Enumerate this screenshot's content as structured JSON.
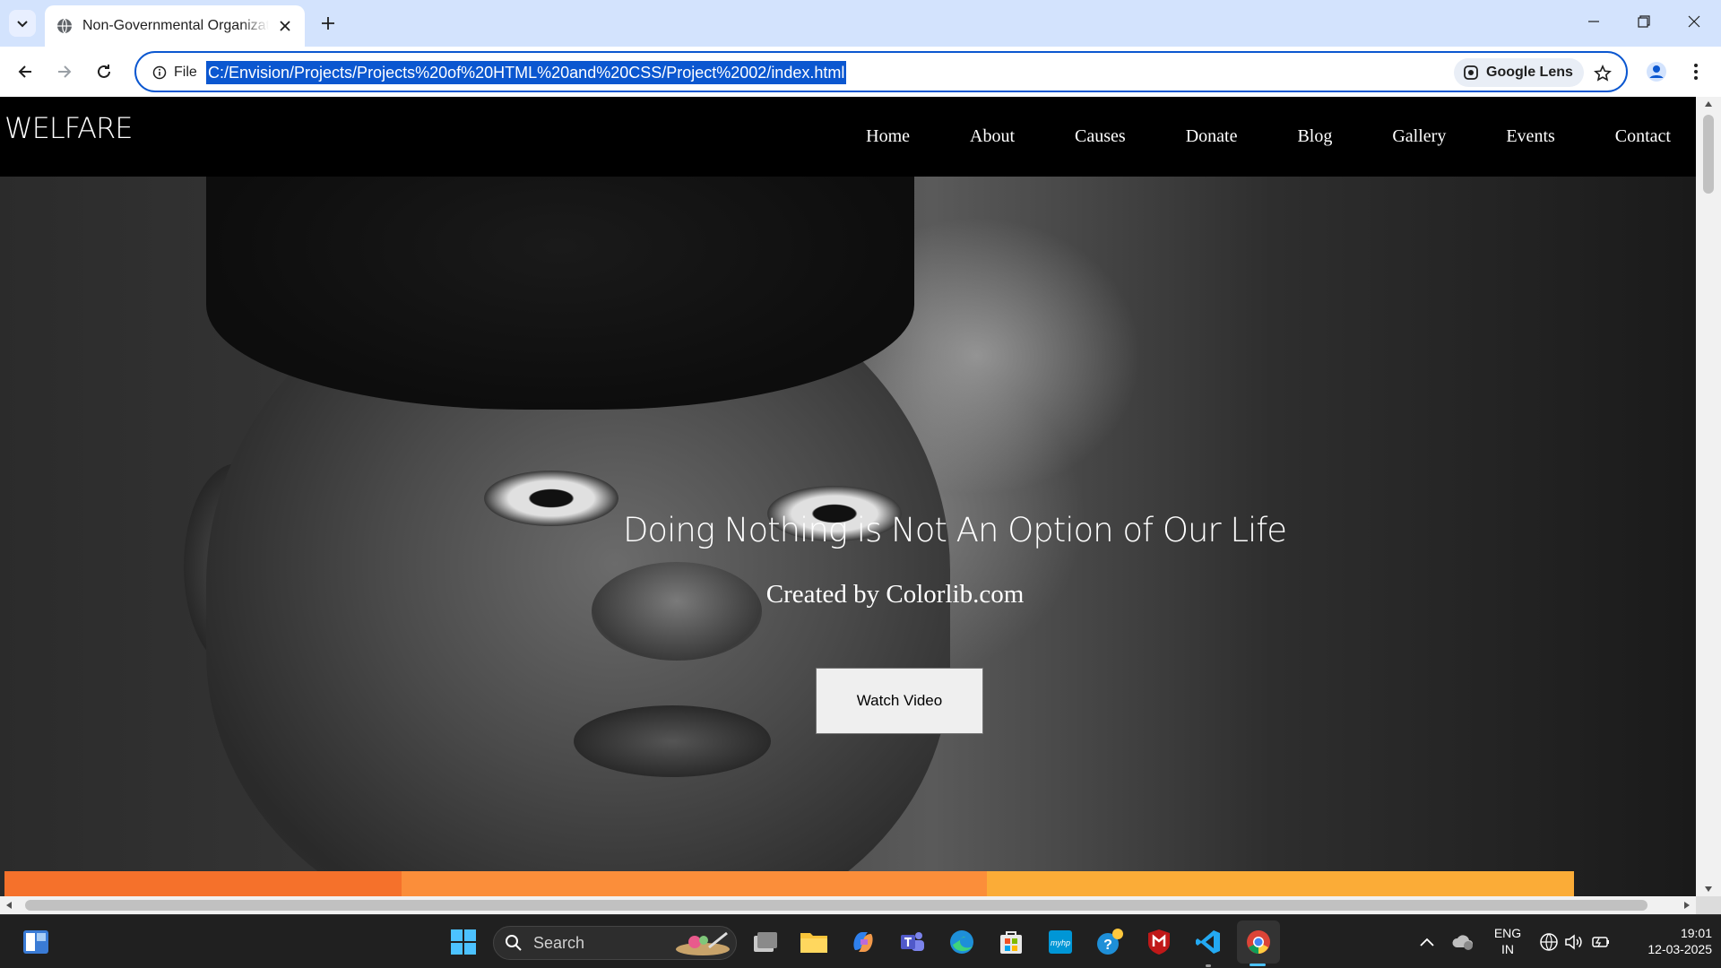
{
  "browser": {
    "tab_title": "Non-Governmental Organization",
    "omnibox_chip": "File",
    "url": "C:/Envision/Projects/Projects%20of%20HTML%20and%20CSS/Project%2002/index.html",
    "lens_label": "Google Lens",
    "accent_color": "#0b57d0"
  },
  "site": {
    "logo": "WELFARE",
    "nav": [
      "Home",
      "About",
      "Causes",
      "Donate",
      "Blog",
      "Gallery",
      "Events",
      "Contact"
    ],
    "hero_title": "Doing Nothing is Not An Option of Our Life",
    "hero_subtitle": "Created by Colorlib.com",
    "hero_button": "Watch Video",
    "bar_colors": [
      "#f5712b",
      "#fb8e3a",
      "#fbac37"
    ]
  },
  "taskbar": {
    "search_placeholder": "Search",
    "lang_top": "ENG",
    "lang_bottom": "IN",
    "time": "19:01",
    "date": "12-03-2025"
  }
}
